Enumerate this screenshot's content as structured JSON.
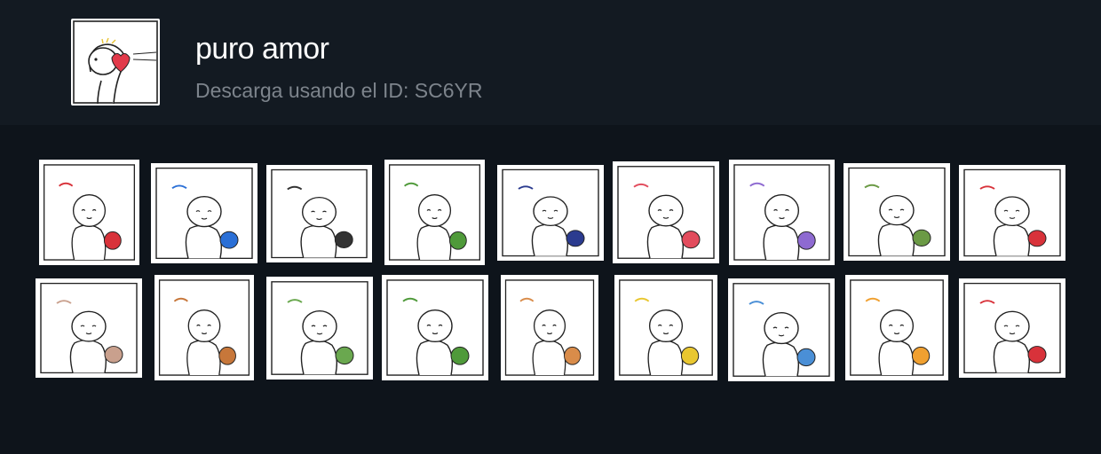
{
  "pack": {
    "title": "puro amor",
    "id_line": "Descarga usando el ID: SC6YR",
    "thumbnail_icon": "heart-blob-icon"
  },
  "stickers": [
    {
      "icon": "basketball-hoop-icon",
      "accent": "#d8323a"
    },
    {
      "icon": "umbrella-rain-icon",
      "accent": "#2a6fd6"
    },
    {
      "icon": "black-cap-icon",
      "accent": "#333333"
    },
    {
      "icon": "beanstalk-icon",
      "accent": "#4f9a3a"
    },
    {
      "icon": "baseball-cap-bat-icon",
      "accent": "#2b3b8f"
    },
    {
      "icon": "red-hood-basket-icon",
      "accent": "#e24c5d"
    },
    {
      "icon": "watering-can-icon",
      "accent": "#8e6ad1"
    },
    {
      "icon": "cooking-music-icon",
      "accent": "#6b9a45"
    },
    {
      "icon": "chinese-bride-icon",
      "accent": "#d8323a"
    },
    {
      "icon": "cat-flower-icon",
      "accent": "#c9a08d"
    },
    {
      "icon": "basketball-player-icon",
      "accent": "#c7773a"
    },
    {
      "icon": "frog-icon",
      "accent": "#6aa84f"
    },
    {
      "icon": "climbing-beanstalk-icon",
      "accent": "#4f9a3a"
    },
    {
      "icon": "ice-cream-rain-icon",
      "accent": "#d98c4a"
    },
    {
      "icon": "butterflies-icon",
      "accent": "#e9c730"
    },
    {
      "icon": "drinking-bottle-icon",
      "accent": "#4a8fd6"
    },
    {
      "icon": "flower-bowl-icon",
      "accent": "#f0a030"
    },
    {
      "icon": "chinese-groom-icon",
      "accent": "#d8323a"
    }
  ]
}
